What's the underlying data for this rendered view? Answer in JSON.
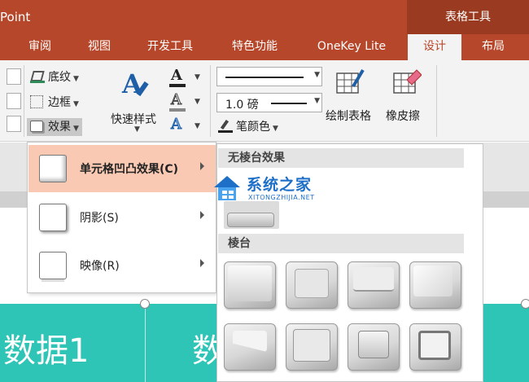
{
  "titlebar": {
    "app_title": "Point",
    "context_header": "表格工具"
  },
  "tabs": [
    {
      "label": "审阅"
    },
    {
      "label": "视图"
    },
    {
      "label": "开发工具"
    },
    {
      "label": "特色功能"
    },
    {
      "label": "OneKey Lite"
    },
    {
      "label": "设计",
      "active": true
    },
    {
      "label": "布局"
    }
  ],
  "ribbon": {
    "shading_label": "底纹",
    "border_label": "边框",
    "effects_label": "效果",
    "quick_styles_label": "快速样式",
    "pen_weight_value": "1.0 磅",
    "pen_color_label": "笔颜色",
    "draw_table_label": "绘制表格",
    "eraser_label": "橡皮擦"
  },
  "menu": {
    "items": [
      {
        "label": "单元格凹凸效果(C)",
        "hovered": true
      },
      {
        "label": "阴影(S)"
      },
      {
        "label": "映像(R)"
      }
    ]
  },
  "gallery": {
    "no_bevel_header": "无棱台效果",
    "bevel_header": "棱台",
    "bevel_tile_count": 8
  },
  "slide": {
    "cell1": "数据1",
    "cell2": "数"
  },
  "watermark": {
    "name": "系统之家",
    "url": "XITONGZHIJIA.NET"
  },
  "colors": {
    "accent": "#b7472a",
    "table_fill": "#2ec4b6",
    "menu_hover": "#f9c9b3",
    "watermark": "#1e6fc8"
  }
}
